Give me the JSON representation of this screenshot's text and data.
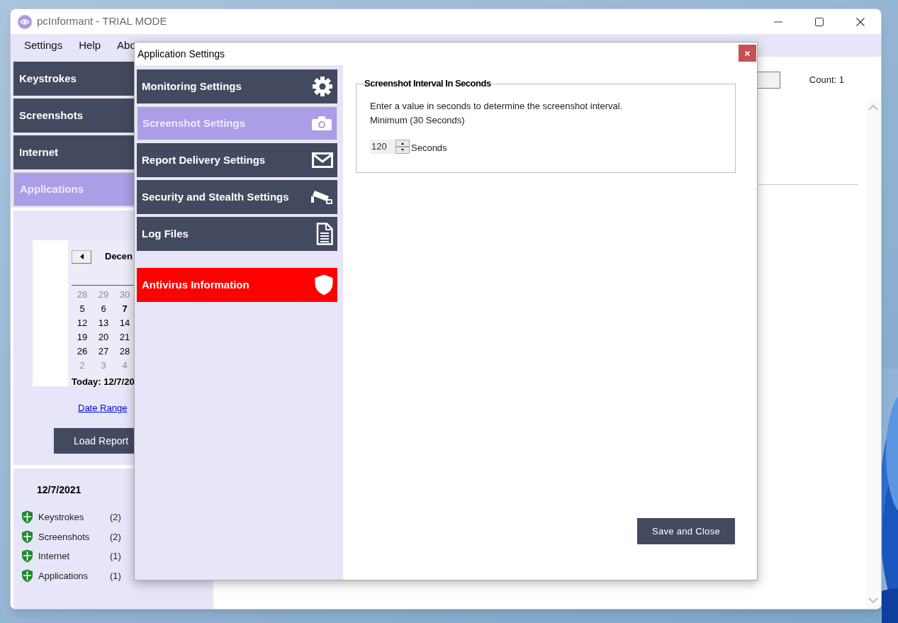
{
  "window": {
    "title": "pcInformant - TRIAL MODE"
  },
  "menu": [
    "Settings",
    "Help",
    "Abo"
  ],
  "sidebar": {
    "items": [
      {
        "label": "Keystrokes",
        "selected": false
      },
      {
        "label": "Screenshots",
        "selected": false
      },
      {
        "label": "Internet",
        "selected": false
      },
      {
        "label": "Applications",
        "selected": true
      }
    ]
  },
  "calendar": {
    "month": "Decen",
    "weeks": [
      [
        {
          "day": "28",
          "other_month": true,
          "today": false
        },
        {
          "day": "29",
          "other_month": true,
          "today": false
        },
        {
          "day": "30",
          "other_month": true,
          "today": false
        }
      ],
      [
        {
          "day": "5",
          "other_month": false,
          "today": false
        },
        {
          "day": "6",
          "other_month": false,
          "today": false
        },
        {
          "day": "7",
          "other_month": false,
          "today": true
        }
      ],
      [
        {
          "day": "12",
          "other_month": false,
          "today": false
        },
        {
          "day": "13",
          "other_month": false,
          "today": false
        },
        {
          "day": "14",
          "other_month": false,
          "today": false
        }
      ],
      [
        {
          "day": "19",
          "other_month": false,
          "today": false
        },
        {
          "day": "20",
          "other_month": false,
          "today": false
        },
        {
          "day": "21",
          "other_month": false,
          "today": false
        }
      ],
      [
        {
          "day": "26",
          "other_month": false,
          "today": false
        },
        {
          "day": "27",
          "other_month": false,
          "today": false
        },
        {
          "day": "28",
          "other_month": false,
          "today": false
        }
      ],
      [
        {
          "day": "2",
          "other_month": true,
          "today": false
        },
        {
          "day": "3",
          "other_month": true,
          "today": false
        },
        {
          "day": "4",
          "other_month": true,
          "today": false
        }
      ]
    ],
    "today": "Today: 12/7/20"
  },
  "date_range_link": "Date Range",
  "load_report_button": "Load Report",
  "summary": {
    "date": "12/7/2021",
    "items": [
      {
        "label": "Keystrokes",
        "count": "(2)"
      },
      {
        "label": "Screenshots",
        "count": "(2)"
      },
      {
        "label": "Internet",
        "count": "(1)"
      },
      {
        "label": "Applications",
        "count": "(1)"
      }
    ]
  },
  "main": {
    "count": "Count: 1"
  },
  "dialog": {
    "title": "Application Settings",
    "nav": [
      {
        "label": "Monitoring Settings",
        "kind": "setting",
        "selected": false
      },
      {
        "label": "Screenshot Settings",
        "kind": "setting",
        "selected": true
      },
      {
        "label": "Report Delivery Settings",
        "kind": "setting",
        "selected": false
      },
      {
        "label": "Security and Stealth Settings",
        "kind": "setting",
        "selected": false
      },
      {
        "label": "Log Files",
        "kind": "setting",
        "selected": false
      },
      {
        "label": "Antivirus Information",
        "kind": "alert",
        "selected": false
      }
    ],
    "group": {
      "title": "Screenshot Interval In Seconds",
      "description": "Enter a value in seconds to determine the screenshot interval.",
      "minimum": "Minimum (30 Seconds)",
      "value": "120",
      "unit": "Seconds"
    },
    "save_button": "Save and Close"
  }
}
